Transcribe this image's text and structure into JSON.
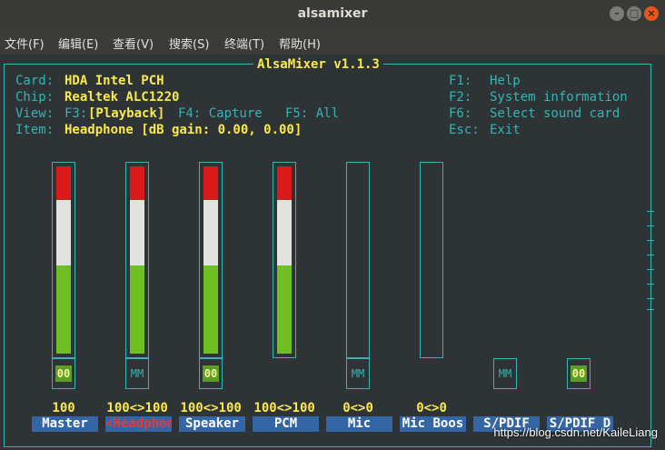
{
  "window": {
    "title": "alsamixer"
  },
  "menu": [
    {
      "label": "文件(F)"
    },
    {
      "label": "编辑(E)"
    },
    {
      "label": "查看(V)"
    },
    {
      "label": "搜索(S)"
    },
    {
      "label": "终端(T)"
    },
    {
      "label": "帮助(H)"
    }
  ],
  "mixer": {
    "title": "AlsaMixer v1.1.3",
    "card_label": "Card:",
    "card_value": "HDA Intel PCH",
    "chip_label": "Chip:",
    "chip_value": "Realtek ALC1220",
    "view_label": "View:",
    "view_f3": "F3:",
    "view_playback": "[Playback]",
    "view_f4": "F4: Capture",
    "view_f5": "F5: All",
    "item_label": "Item:",
    "item_value": "Headphone [dB gain: 0.00, 0.00]",
    "help": [
      {
        "key": "F1:",
        "text": "Help"
      },
      {
        "key": "F2:",
        "text": "System information"
      },
      {
        "key": "F6:",
        "text": "Select sound card"
      },
      {
        "key": "Esc:",
        "text": "Exit"
      }
    ]
  },
  "channels": [
    {
      "name": "Master",
      "level_text": "100",
      "level": 1.0,
      "switch": "00",
      "switch_on": true
    },
    {
      "name": "<Headphon>",
      "level_text": "100<>100",
      "level": 1.0,
      "switch": "MM",
      "switch_on": false,
      "selected": true
    },
    {
      "name": "Speaker",
      "level_text": "100<>100",
      "level": 1.0,
      "switch": "00",
      "switch_on": true
    },
    {
      "name": "PCM",
      "level_text": "100<>100",
      "level": 1.0,
      "switch": "",
      "switch_on": false
    },
    {
      "name": "Mic",
      "level_text": "0<>0",
      "level": 0.0,
      "switch": "MM",
      "switch_on": false
    },
    {
      "name": "Mic Boos",
      "level_text": "0<>0",
      "level": 0.0,
      "switch": "",
      "switch_on": false
    },
    {
      "name": "S/PDIF",
      "level_text": "",
      "level": 0.0,
      "switch": "MM",
      "switch_on": false
    },
    {
      "name": "S/PDIF D",
      "level_text": "",
      "level": 0.0,
      "switch": "00",
      "switch_on": true
    }
  ],
  "watermark": "https://blog.csdn.net/KaileLiang"
}
